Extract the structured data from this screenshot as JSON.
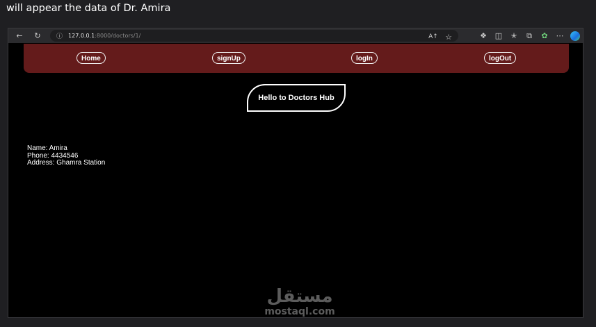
{
  "caption": "will appear the data of Dr. Amira",
  "browser": {
    "url_host": "127.0.0.1",
    "url_path": ":8000/doctors/1/",
    "icons": {
      "back": "back-arrow-icon",
      "refresh": "refresh-icon",
      "info": "info-icon",
      "read_aloud": "read-aloud-icon",
      "favorite": "star-icon",
      "extensions": "puzzle-icon",
      "split": "split-screen-icon",
      "favorites_bar": "favorites-icon",
      "collections": "collections-icon",
      "performance": "performance-icon",
      "more": "more-icon",
      "copilot": "copilot-icon"
    }
  },
  "navbar": {
    "home": "Home",
    "signup": "signUp",
    "login": "logIn",
    "logout": "logOut",
    "bg_color": "#641b1b"
  },
  "hero": {
    "title": "Hello to Doctors Hub"
  },
  "doctor": {
    "name": "Name: Amira",
    "phone": "Phone: 4434546",
    "address": "Address: Ghamra Station"
  },
  "watermark": {
    "arabic": "مستقل",
    "latin": "mostaql.com"
  }
}
